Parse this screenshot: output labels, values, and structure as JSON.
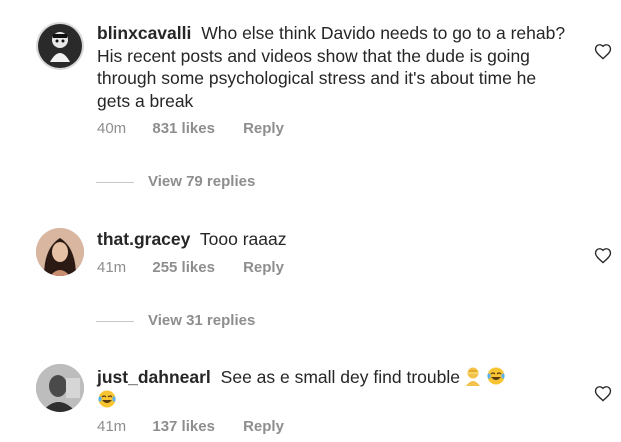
{
  "comments": [
    {
      "username": "blinxcavalli",
      "text": "Who else think Davido needs to go to a rehab? His recent posts and videos show that the dude is going through some psychological stress and it's about time he gets a break",
      "time": "40m",
      "likes": "831 likes",
      "reply": "Reply",
      "view_replies": "View 79 replies",
      "avatar_icon": "avatar-dark-artwork"
    },
    {
      "username": "that.gracey",
      "text": "Tooo raaaz",
      "time": "41m",
      "likes": "255 likes",
      "reply": "Reply",
      "view_replies": "View 31 replies",
      "avatar_icon": "avatar-woman-photo"
    },
    {
      "username": "just_dahnearl",
      "text": "See as e small dey find trouble",
      "time": "41m",
      "likes": "137 likes",
      "reply": "Reply",
      "emojis": [
        "person-facepalming-emoji",
        "face-with-tears-of-joy-emoji",
        "face-with-tears-of-joy-emoji"
      ],
      "avatar_icon": "avatar-man-photo"
    }
  ],
  "colors": {
    "text": "#262626",
    "secondary": "#8e8e8e",
    "divider": "#c7c7c7"
  }
}
